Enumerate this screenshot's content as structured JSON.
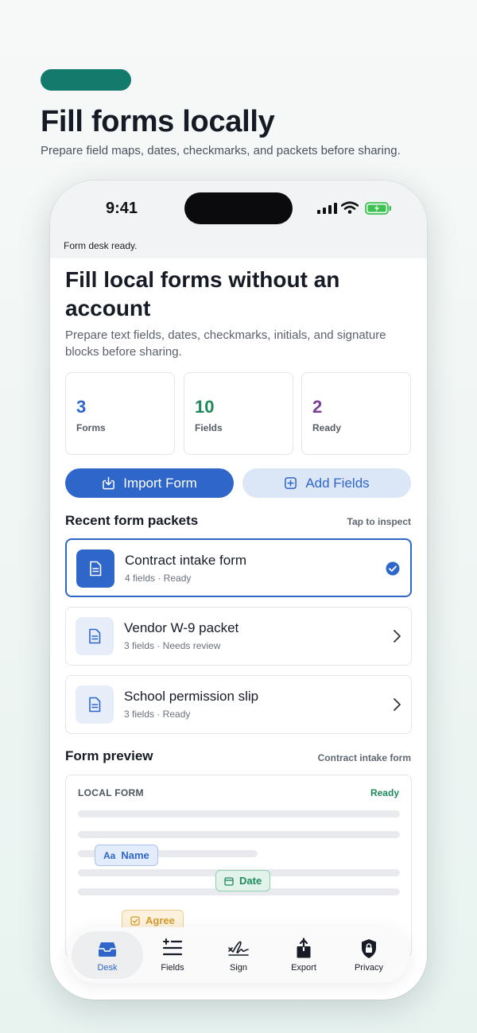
{
  "promo": {
    "title": "Fill forms locally",
    "subtitle": "Prepare field maps, dates, checkmarks, and packets before sharing."
  },
  "status_bar": {
    "time": "9:41"
  },
  "toast": "Form desk ready.",
  "hero": {
    "title": "Fill local forms without an account",
    "description": "Prepare text fields, dates, checkmarks, initials, and signature blocks before sharing."
  },
  "stats": [
    {
      "value": "3",
      "label": "Forms",
      "color": "#2f66c9"
    },
    {
      "value": "10",
      "label": "Fields",
      "color": "#1e8a5c"
    },
    {
      "value": "2",
      "label": "Ready",
      "color": "#7b3f98"
    }
  ],
  "actions": {
    "import_label": "Import Form",
    "add_label": "Add Fields"
  },
  "packets_section": {
    "title": "Recent form packets",
    "hint": "Tap to inspect",
    "items": [
      {
        "title": "Contract intake form",
        "subtitle": "4 fields · Ready",
        "selected": true
      },
      {
        "title": "Vendor W-9 packet",
        "subtitle": "3 fields · Needs review",
        "selected": false
      },
      {
        "title": "School permission slip",
        "subtitle": "3 fields · Ready",
        "selected": false
      }
    ]
  },
  "preview_section": {
    "title": "Form preview",
    "current": "Contract intake form",
    "label": "LOCAL FORM",
    "status": "Ready",
    "fields": {
      "name": "Name",
      "date": "Date",
      "agree": "Agree"
    }
  },
  "tabs": [
    {
      "label": "Desk",
      "icon": "inbox-tray-icon",
      "active": true
    },
    {
      "label": "Fields",
      "icon": "add-list-icon",
      "active": false
    },
    {
      "label": "Sign",
      "icon": "signature-icon",
      "active": false
    },
    {
      "label": "Export",
      "icon": "share-icon",
      "active": false
    },
    {
      "label": "Privacy",
      "icon": "lock-shield-icon",
      "active": false
    }
  ],
  "colors": {
    "accent": "#2f66c9",
    "brand": "#137a6c",
    "success": "#1e8a5c",
    "warning": "#d59b2b"
  }
}
